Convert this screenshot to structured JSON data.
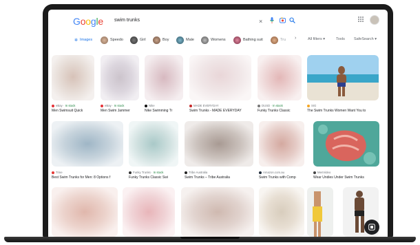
{
  "search": {
    "logo": "Google",
    "query": "swim trunks",
    "clear_icon": "close-icon",
    "voice_icon": "mic-icon",
    "lens_icon": "camera-icon",
    "search_icon": "search-icon"
  },
  "header": {
    "apps_icon": "apps-grid-icon",
    "avatar": "avatar"
  },
  "chips": [
    {
      "label": "Images",
      "active": true
    },
    {
      "label": "Speedo"
    },
    {
      "label": "Girl"
    },
    {
      "label": "Boy"
    },
    {
      "label": "Male"
    },
    {
      "label": "Womens"
    },
    {
      "label": "Bathing suit"
    },
    {
      "label": "Tru"
    }
  ],
  "tools": {
    "all_filters": "All filters ▾",
    "tools": "Tools",
    "safesearch": "SafeSearch ▾",
    "chevron": "›"
  },
  "results": [
    {
      "source": "eBay",
      "stock": "In stock",
      "caption": "Men Swimsuit Quick"
    },
    {
      "source": "eBay",
      "stock": "In stock",
      "caption": "Men Swim Jammer"
    },
    {
      "source": "Nike",
      "stock": "",
      "caption": "Nike Swimming Tr"
    },
    {
      "source": "MADE EVERYDAY",
      "stock": "",
      "caption": "Swim Trunks - MADE EVERYDAY"
    },
    {
      "source": "DUSD",
      "stock": "In stock",
      "caption": "Funky Trunks Classic"
    },
    {
      "source": "SIG",
      "stock": "",
      "caption": "The Swim Trunks Women Want You to"
    },
    {
      "source": "Trine",
      "stock": "",
      "caption": "Best Swim Trunks for Men: 8 Options f"
    },
    {
      "source": "Funky Trunks",
      "stock": "In stock",
      "caption": "Funky Trunks Classic Swi"
    },
    {
      "source": "Tribe Australia",
      "stock": "",
      "caption": "Swim Trunks – Tribe Australia"
    },
    {
      "source": "Amazon.com.au",
      "stock": "",
      "caption": "Swim Trunks with Comp"
    },
    {
      "source": "MenVideo",
      "stock": "",
      "caption": "Wear Undies Under Swim Trunks"
    }
  ],
  "fab_icon": "lens-feedback-icon",
  "colors": {
    "google_blue": "#4285F4",
    "google_red": "#EA4335",
    "google_yellow": "#FBBC05",
    "google_green": "#34A853"
  }
}
